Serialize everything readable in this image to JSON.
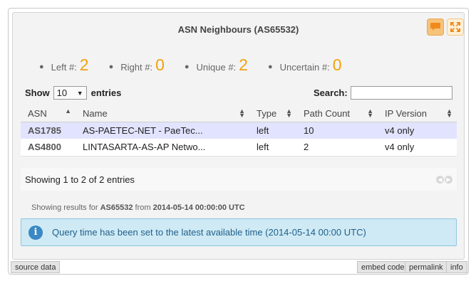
{
  "widget": {
    "title": "ASN Neighbours (AS65532)",
    "icons": [
      "speech-bubble-icon",
      "expand-icon"
    ]
  },
  "stats": [
    {
      "label": "Left #:",
      "value": "2"
    },
    {
      "label": "Right #:",
      "value": "0"
    },
    {
      "label": "Unique #:",
      "value": "2"
    },
    {
      "label": "Uncertain #:",
      "value": "0"
    }
  ],
  "controls": {
    "show_label": "Show",
    "page_size": "10",
    "entries_label": "entries",
    "search_label": "Search:",
    "search_value": ""
  },
  "table": {
    "headers": [
      "ASN",
      "Name",
      "Type",
      "Path Count",
      "IP Version"
    ],
    "rows": [
      {
        "asn": "AS1785",
        "name": "AS-PAETEC-NET - PaeTec...",
        "type": "left",
        "path_count": "10",
        "ip_version": "v4 only"
      },
      {
        "asn": "AS4800",
        "name": "LINTASARTA-AS-AP Netwo...",
        "type": "left",
        "path_count": "2",
        "ip_version": "v4 only"
      }
    ]
  },
  "footer": {
    "info": "Showing 1 to 2 of 2 entries"
  },
  "results": {
    "prefix": "Showing results for",
    "resource": "AS65532",
    "middle": "from",
    "time": "2014-05-14 00:00:00 UTC"
  },
  "notice": {
    "icon": "info-icon",
    "text": "Query time has been set to the latest available time (2014-05-14 00:00 UTC)"
  },
  "bottom_bar": {
    "source": "source data",
    "embed": "embed code",
    "permalink": "permalink",
    "info": "info"
  },
  "colors": {
    "accent_number": "#f0a30a",
    "selected_row": "#e2e4ff",
    "notice_bg": "#cfeaf4"
  }
}
